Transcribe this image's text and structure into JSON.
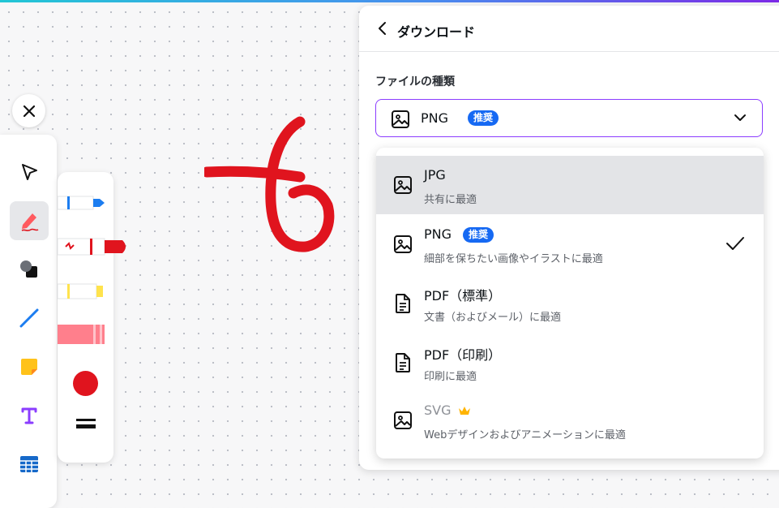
{
  "download": {
    "title": "ダウンロード",
    "file_type_label": "ファイルの種類",
    "selected": {
      "name": "PNG",
      "badge": "推奨"
    },
    "options": [
      {
        "name": "JPG",
        "desc": "共有に最適",
        "icon": "image-icon",
        "highlighted": true
      },
      {
        "name": "PNG",
        "badge": "推奨",
        "desc": "細部を保ちたい画像やイラストに最適",
        "icon": "image-icon",
        "selected": true
      },
      {
        "name": "PDF（標準）",
        "desc": "文書（およびメール）に最適",
        "icon": "document-icon"
      },
      {
        "name": "PDF（印刷）",
        "desc": "印刷に最適",
        "icon": "document-icon"
      },
      {
        "name": "SVG",
        "desc": "Webデザインおよびアニメーションに最適",
        "icon": "image-icon",
        "premium": true
      }
    ]
  },
  "toolbar": {
    "tools": [
      "select-tool",
      "pen-tool",
      "shape-tool",
      "line-tool",
      "sticky-note-tool",
      "text-tool",
      "table-tool"
    ],
    "active": "pen-tool"
  },
  "pen_panel": {
    "pens": [
      "blue-pen",
      "red-marker",
      "yellow-highlighter",
      "pink-eraser"
    ],
    "selected_color": "#e0141e"
  },
  "colors": {
    "accent": "#8b3dff",
    "badge": "#1669f3",
    "stroke": "#e0141e"
  }
}
